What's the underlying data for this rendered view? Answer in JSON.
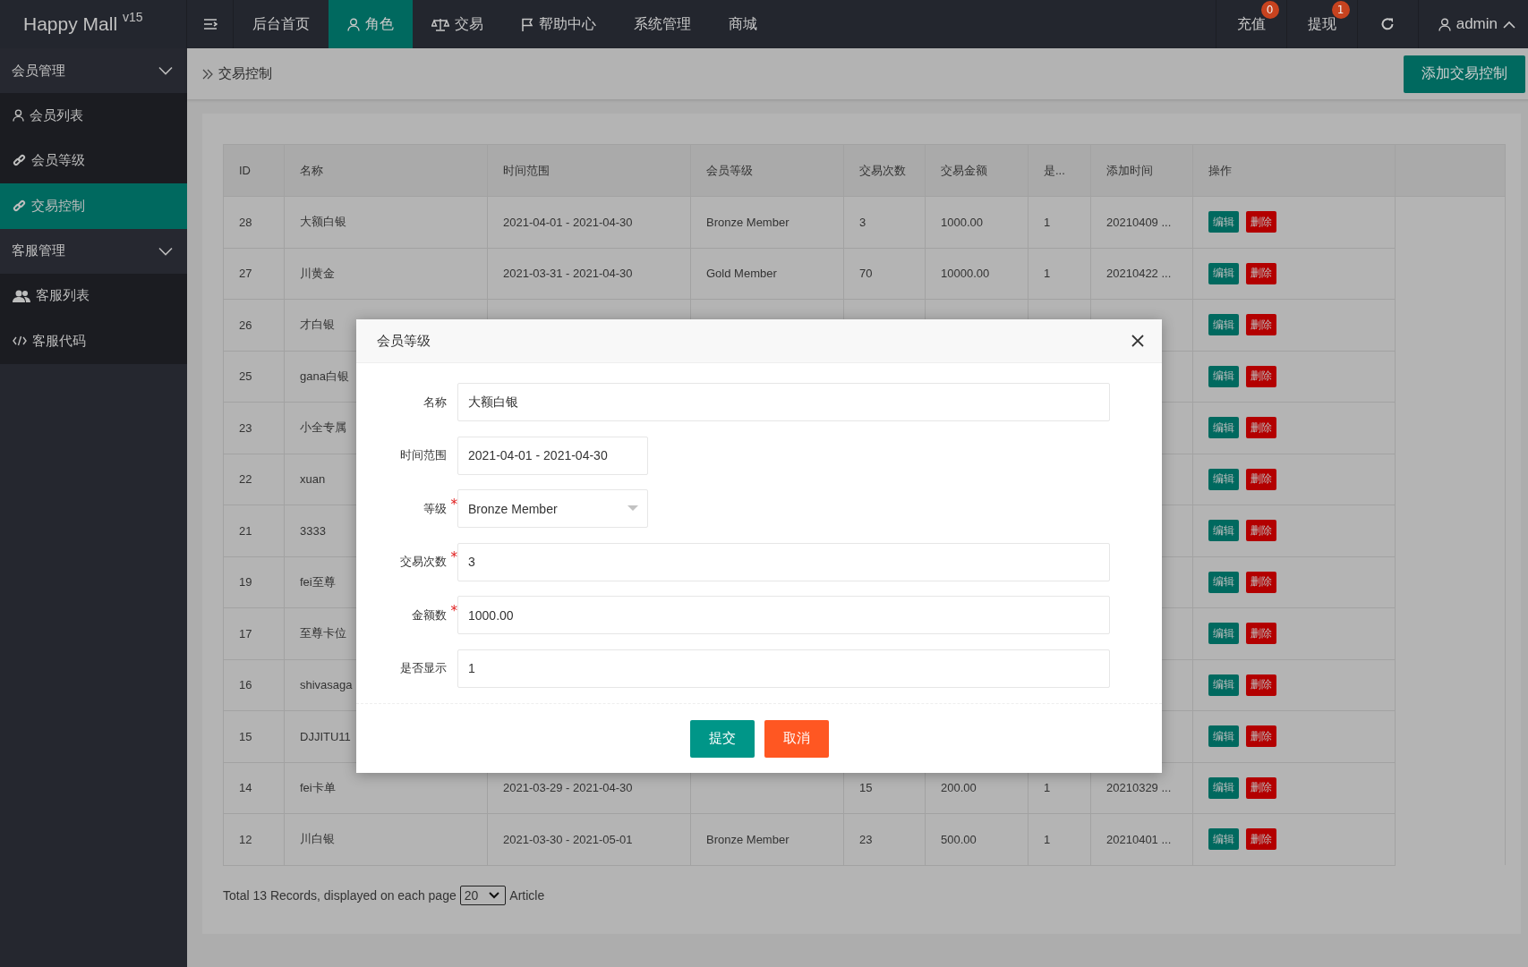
{
  "header": {
    "logo": "Happy Mall",
    "version": "v15",
    "nav": [
      {
        "label": "后台首页",
        "selected": false
      },
      {
        "label": "角色",
        "selected": true
      },
      {
        "label": "交易",
        "selected": false
      },
      {
        "label": "帮助中心",
        "selected": false
      },
      {
        "label": "系统管理",
        "selected": false
      },
      {
        "label": "商城",
        "selected": false
      }
    ],
    "actions": [
      {
        "label": "充值",
        "badge": "0"
      },
      {
        "label": "提现",
        "badge": "1"
      }
    ],
    "user": "admin"
  },
  "sidebar": {
    "groups": [
      {
        "label": "会员管理",
        "expanded": true,
        "items": [
          {
            "label": "会员列表",
            "selected": false
          },
          {
            "label": "会员等级",
            "selected": false
          },
          {
            "label": "交易控制",
            "selected": true
          }
        ]
      },
      {
        "label": "客服管理",
        "expanded": true,
        "items": [
          {
            "label": "客服列表",
            "selected": false
          },
          {
            "label": "客服代码",
            "selected": false
          }
        ]
      }
    ]
  },
  "breadcrumb": "交易控制",
  "add_button": "添加交易控制",
  "table": {
    "columns": [
      "ID",
      "名称",
      "时间范围",
      "会员等级",
      "交易次数",
      "交易金额",
      "是...",
      "添加时间",
      "操作"
    ],
    "rows": [
      {
        "id": "28",
        "name": "大额白银",
        "time_range": "2021-04-01 - 2021-04-30",
        "level": "Bronze Member",
        "count": "3",
        "amount": "1000.00",
        "show": "1",
        "added": "20210409 ...",
        "edit": "编辑",
        "delete": "删除"
      },
      {
        "id": "27",
        "name": "川黄金",
        "time_range": "2021-03-31 - 2021-04-30",
        "level": "Gold Member",
        "count": "70",
        "amount": "10000.00",
        "show": "1",
        "added": "20210422 ...",
        "edit": "编辑",
        "delete": "删除"
      },
      {
        "id": "26",
        "name": "才白银",
        "edit": "编辑",
        "delete": "删除"
      },
      {
        "id": "25",
        "name": "gana白银",
        "edit": "编辑",
        "delete": "删除"
      },
      {
        "id": "23",
        "name": "小全专属",
        "edit": "编辑",
        "delete": "删除"
      },
      {
        "id": "22",
        "name": "xuan",
        "edit": "编辑",
        "delete": "删除"
      },
      {
        "id": "21",
        "name": "3333",
        "edit": "编辑",
        "delete": "删除"
      },
      {
        "id": "19",
        "name": "fei至尊",
        "edit": "编辑",
        "delete": "删除"
      },
      {
        "id": "17",
        "name": "至尊卡位",
        "edit": "编辑",
        "delete": "删除"
      },
      {
        "id": "16",
        "name": "shivasaga",
        "edit": "编辑",
        "delete": "删除"
      },
      {
        "id": "15",
        "name": "DJJITU11",
        "edit": "编辑",
        "delete": "删除"
      },
      {
        "id": "14",
        "name": "fei卡单",
        "time_range": "2021-03-29 - 2021-04-30",
        "count": "15",
        "amount": "200.00",
        "show": "1",
        "added": "20210329 ...",
        "edit": "编辑",
        "delete": "删除"
      },
      {
        "id": "12",
        "name": "川白银",
        "time_range": "2021-03-30 - 2021-05-01",
        "level": "Bronze Member",
        "count": "23",
        "amount": "500.00",
        "show": "1",
        "added": "20210401 ...",
        "edit": "编辑",
        "delete": "删除"
      }
    ]
  },
  "pagination": {
    "text_before": "Total 13 Records, displayed on each page",
    "page_size": "20",
    "text_after": "Article"
  },
  "dialog": {
    "title": "会员等级",
    "fields": [
      {
        "label": "名称",
        "kind": "text",
        "value": "大额白银"
      },
      {
        "label": "时间范围",
        "kind": "short-text",
        "value": "2021-04-01 - 2021-04-30"
      },
      {
        "label": "等级",
        "kind": "select",
        "required_mark": "*",
        "value": "Bronze Member"
      },
      {
        "label": "交易次数",
        "kind": "text",
        "required_mark": "*",
        "value": "3"
      },
      {
        "label": "金额数",
        "kind": "text",
        "required_mark": "*",
        "value": "1000.00"
      },
      {
        "label": "是否显示",
        "kind": "text",
        "value": "1"
      }
    ],
    "buttons": [
      {
        "label": "提交",
        "kind": "primary"
      },
      {
        "label": "取消",
        "kind": "warning"
      }
    ]
  }
}
